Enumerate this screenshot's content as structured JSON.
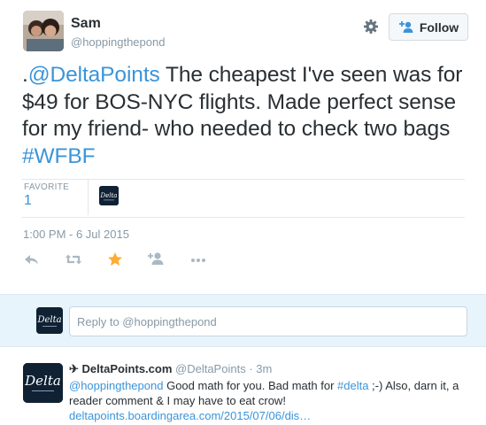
{
  "tweet": {
    "author_name": "Sam",
    "author_handle": "@hoppingthepond",
    "follow_label": "Follow",
    "text_parts": {
      "prefix": ".",
      "mention": "@DeltaPoints",
      "body": " The cheapest I've seen was for $49 for BOS-NYC flights. Made perfect sense for my friend- who needed to check two bags ",
      "hashtag": "#WFBF"
    },
    "stats": {
      "favorite_label": "FAVORITE",
      "favorite_count": "1"
    },
    "timestamp": "1:00 PM - 6 Jul 2015",
    "icons": {
      "settings": "gear-icon",
      "follow": "add-user-icon",
      "reply": "reply-icon",
      "retweet": "retweet-icon",
      "favorite": "star-icon",
      "add_to_list": "add-user-icon",
      "more": "more-icon"
    },
    "colors": {
      "link": "#3b94d9",
      "favorite_active": "#ffac33",
      "muted": "#8899a6"
    }
  },
  "reply_box": {
    "placeholder": "Reply to @hoppingthepond"
  },
  "reply_tweet": {
    "plane": "✈",
    "name": "DeltaPoints.com",
    "handle": "@DeltaPoints",
    "time": "· 3m",
    "mention": "@hoppingthepond",
    "text_1": " Good math for you. Bad math for ",
    "hashtag": "#delta",
    "text_2": " ;-) Also, darn it, a reader comment & I may have to eat crow! ",
    "url": "deltapoints.boardingarea.com/2015/07/06/dis…",
    "avatar_text": "Delta"
  }
}
